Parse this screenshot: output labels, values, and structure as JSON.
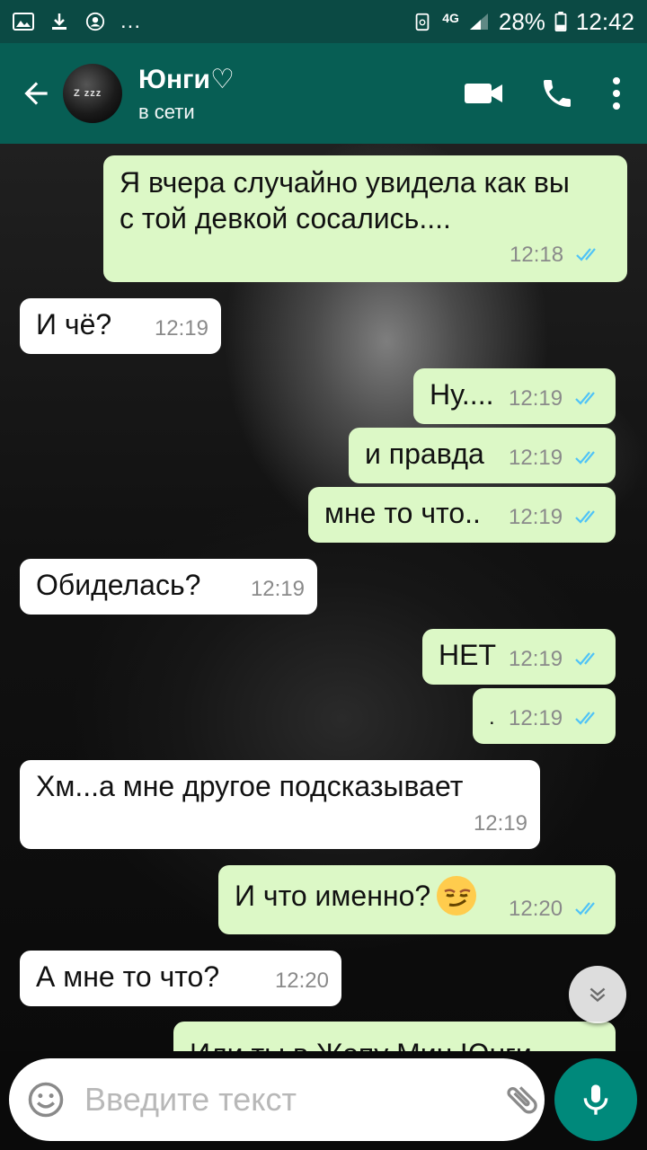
{
  "status_bar": {
    "battery": "28%",
    "time": "12:42",
    "network": "4G",
    "overflow": "..."
  },
  "header": {
    "contact_name": "Юнги♡",
    "contact_status": "в сети",
    "icons": [
      "back-arrow-icon",
      "video-call-icon",
      "phone-call-icon",
      "more-vert-icon"
    ]
  },
  "messages": [
    {
      "dir": "out",
      "text": "Я вчера случайно увидела как вы с той девкой сосались....",
      "time": "12:18"
    },
    {
      "dir": "in",
      "text": "И чё?",
      "time": "12:19"
    },
    {
      "dir": "out",
      "text": "Ну....",
      "time": "12:19"
    },
    {
      "dir": "out",
      "text": "и правда",
      "time": "12:19"
    },
    {
      "dir": "out",
      "text": "мне то что..",
      "time": "12:19"
    },
    {
      "dir": "in",
      "text": "Обиделась?",
      "time": "12:19"
    },
    {
      "dir": "out",
      "text": "НЕТ",
      "time": "12:19"
    },
    {
      "dir": "out",
      "text": ".",
      "time": "12:19"
    },
    {
      "dir": "in",
      "text": "Хм...а мне другое подсказывает",
      "time": "12:19"
    },
    {
      "dir": "out",
      "text": "И что именно?",
      "emoji": "smirk",
      "time": "12:20"
    },
    {
      "dir": "in",
      "text": "А мне то что?",
      "time": "12:20"
    },
    {
      "dir": "out",
      "text": "Или ты в Жопу Мин Юнги",
      "time": "",
      "partial": true
    }
  ],
  "input": {
    "placeholder": "Введите текст",
    "value": ""
  },
  "colors": {
    "statusbar": "#0b4a44",
    "appbar": "#075e54",
    "outgoing_bubble": "#dcf8c6",
    "incoming_bubble": "#ffffff",
    "read_ticks": "#4fc3f7",
    "mic_button": "#00897b"
  }
}
